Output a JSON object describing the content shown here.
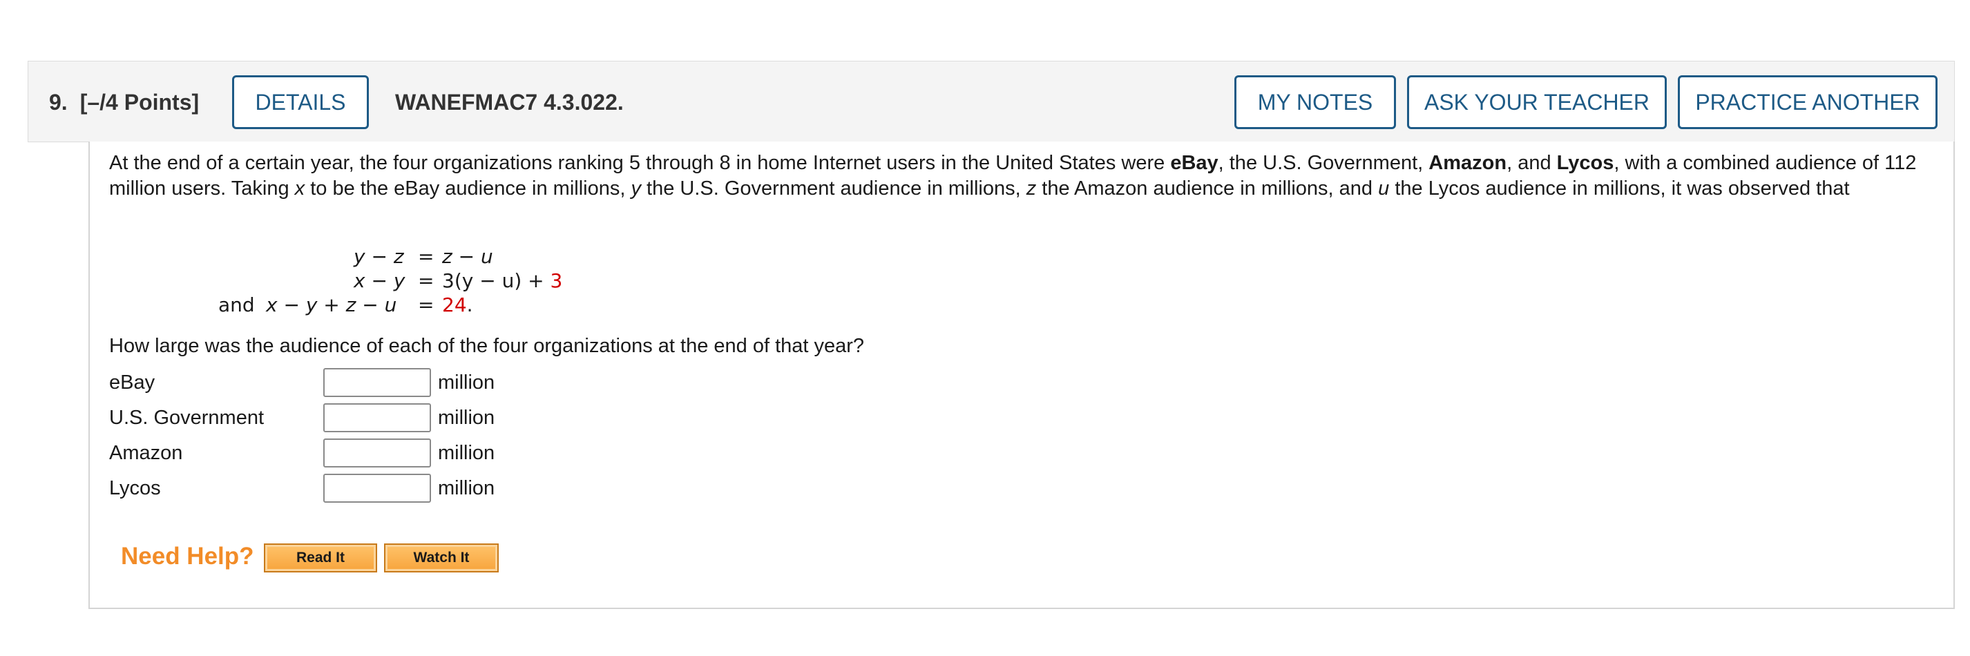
{
  "header": {
    "question_number": "9.",
    "points": "[–/4 Points]",
    "details_label": "DETAILS",
    "question_code": "WANEFMAC7 4.3.022.",
    "my_notes_label": "MY NOTES",
    "ask_teacher_label": "ASK YOUR TEACHER",
    "practice_label": "PRACTICE ANOTHER"
  },
  "problem": {
    "p1": "At the end of a certain year, the four organizations ranking 5 through 8 in home Internet users in the United States were ",
    "org1": "eBay",
    "p2": ", the U.S. Government, ",
    "org2": "Amazon",
    "p3": ", and ",
    "org3": "Lycos",
    "p4": ", with a combined audience of 112 million users. Taking ",
    "var_x": "x",
    "p5": " to be the eBay audience in millions, ",
    "var_y": "y",
    "p6": " the U.S. Government audience in millions, ",
    "var_z": "z",
    "p7": " the Amazon audience in millions, and ",
    "var_u": "u",
    "p8": " the Lycos audience in millions, it was observed that"
  },
  "equations": {
    "eq1_lhs": "y − z",
    "eq1_eq": "=",
    "eq1_rhs": "z − u",
    "eq2_lhs": "x − y",
    "eq2_eq": "=",
    "eq2_rhs": "3(y − u) + ",
    "eq2_const": "3",
    "eq3_prefix": "and",
    "eq3_lhs": "x − y + z − u",
    "eq3_eq": "=",
    "eq3_const": "24",
    "eq3_period": "."
  },
  "question": "How large was the audience of each of the four organizations at the end of that year?",
  "answers": [
    {
      "label": "eBay",
      "value": "",
      "unit": "million"
    },
    {
      "label": "U.S. Government",
      "value": "",
      "unit": "million"
    },
    {
      "label": "Amazon",
      "value": "",
      "unit": "million"
    },
    {
      "label": "Lycos",
      "value": "",
      "unit": "million"
    }
  ],
  "help": {
    "need_help": "Need Help?",
    "read_it": "Read It",
    "watch_it": "Watch It"
  },
  "colors": {
    "accent_blue": "#1d5a86",
    "help_orange": "#f28c28",
    "value_red": "#d10000"
  }
}
